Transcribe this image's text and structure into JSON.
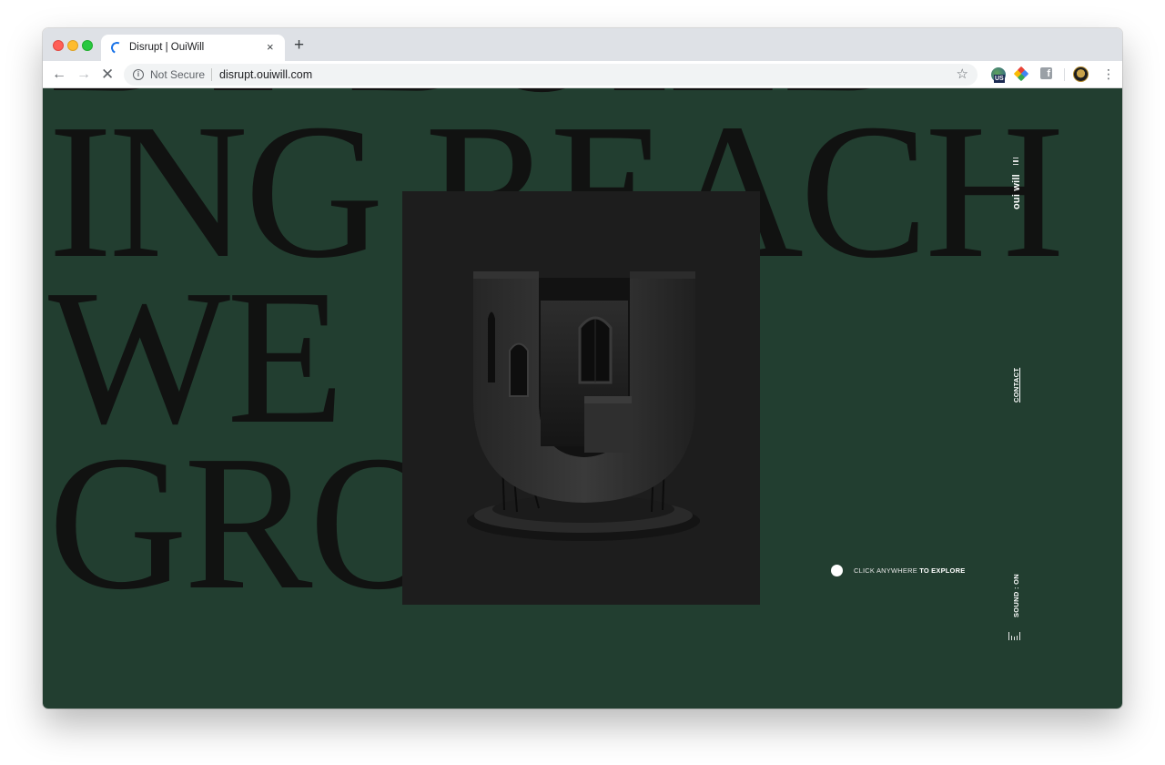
{
  "browser": {
    "tab_title": "Disrupt | OuiWill",
    "tab_close": "×",
    "new_tab": "+",
    "security_label": "Not Secure",
    "url": "disrupt.ouiwill.com",
    "ext_globe_badge": "US",
    "ext_fb_letter": "f"
  },
  "page": {
    "headline_lines": [
      "BY BUILD-",
      "ING REACH",
      "WE",
      "GROW"
    ],
    "logo": "oui will",
    "contact_label": "CONTACT",
    "sound_label": "SOUND : ON",
    "explore_prefix": "CLICK ANYWHERE",
    "explore_emphasis": "TO EXPLORE"
  },
  "colors": {
    "page_background": "#223e30",
    "headline_text": "#111211",
    "art_panel": "#1d1d1d"
  },
  "icons": {
    "tab": "loading-spinner-icon",
    "toolbar": [
      "back-arrow-icon",
      "forward-arrow-icon",
      "stop-icon",
      "info-icon",
      "star-icon",
      "globe-extension-icon",
      "pinwheel-extension-icon",
      "facebook-extension-icon",
      "avatar",
      "kebab-menu-icon"
    ]
  }
}
